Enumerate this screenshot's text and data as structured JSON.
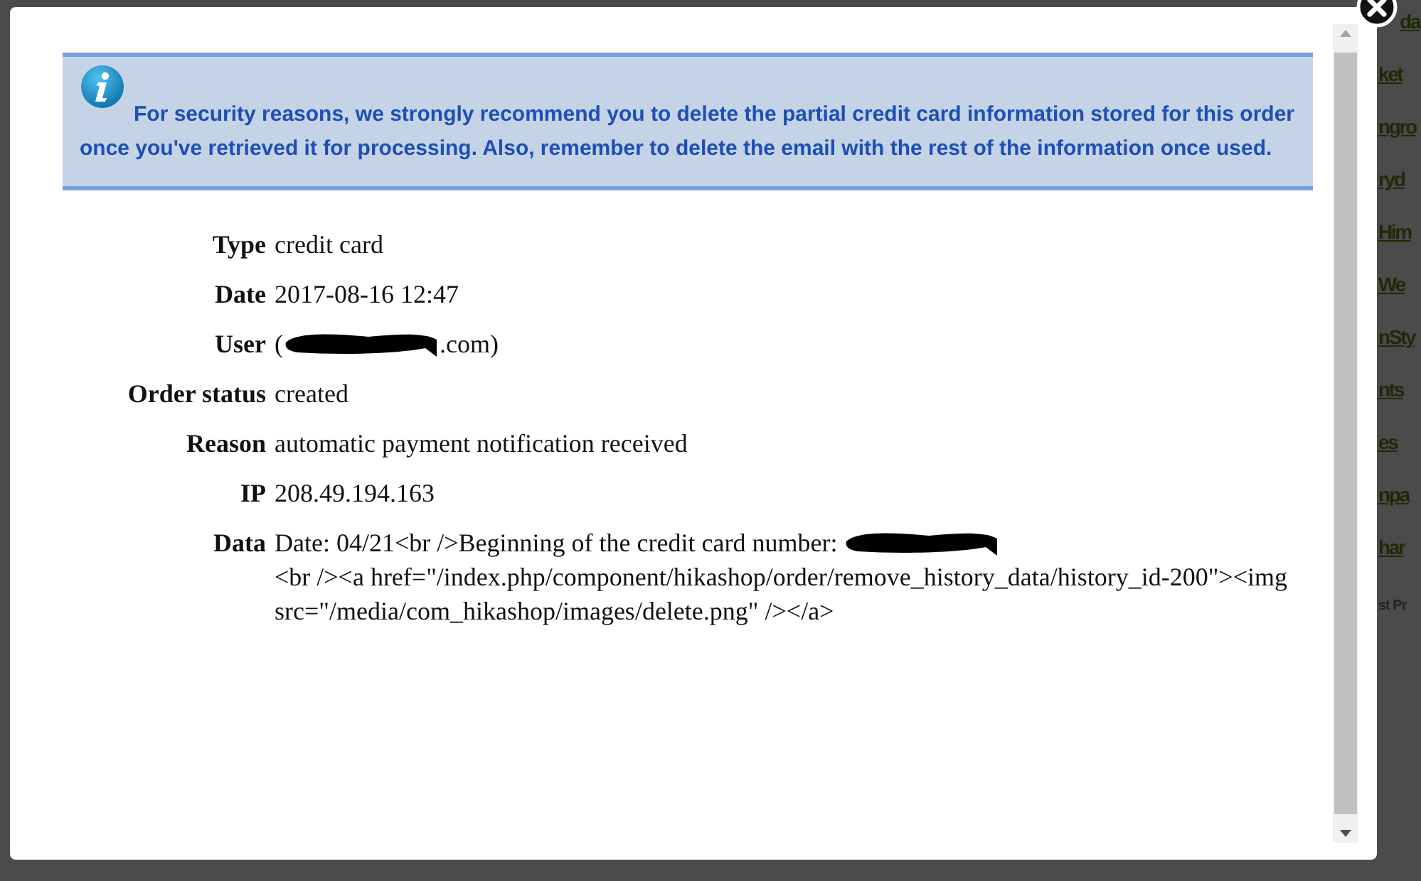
{
  "background_links": [
    "da",
    "ket",
    "ngro",
    "ryd",
    "Him",
    "We",
    "nSty",
    "nts",
    "es",
    "npa",
    "har"
  ],
  "background_text": "st Pr",
  "notice": {
    "text": "For security reasons, we strongly recommend you to delete the partial credit card information stored for this order once you've retrieved it for processing. Also, remember to delete the email with the rest of the information once used."
  },
  "details": [
    {
      "label": "Type",
      "value": [
        {
          "kind": "text",
          "text": "credit card"
        }
      ]
    },
    {
      "label": "Date",
      "value": [
        {
          "kind": "text",
          "text": "2017-08-16 12:47"
        }
      ]
    },
    {
      "label": "User",
      "value": [
        {
          "kind": "text",
          "text": "("
        },
        {
          "kind": "redaction"
        },
        {
          "kind": "text",
          "text": ".com)"
        }
      ]
    },
    {
      "label": "Order status",
      "value": [
        {
          "kind": "text",
          "text": "created"
        }
      ]
    },
    {
      "label": "Reason",
      "value": [
        {
          "kind": "text",
          "text": "automatic payment notification received"
        }
      ]
    },
    {
      "label": "IP",
      "value": [
        {
          "kind": "text",
          "text": "208.49.194.163"
        }
      ]
    },
    {
      "label": "Data",
      "value": [
        {
          "kind": "text",
          "text": "Date: 04/21<br />Beginning of the credit card number: "
        },
        {
          "kind": "redaction"
        },
        {
          "kind": "text",
          "text": "<br /><a href=\"/index.php/component/hikashop/order/remove_history_data/history_id-200\"><img src=\"/media/com_hikashop/images/delete.png\" /></a>"
        }
      ]
    }
  ]
}
